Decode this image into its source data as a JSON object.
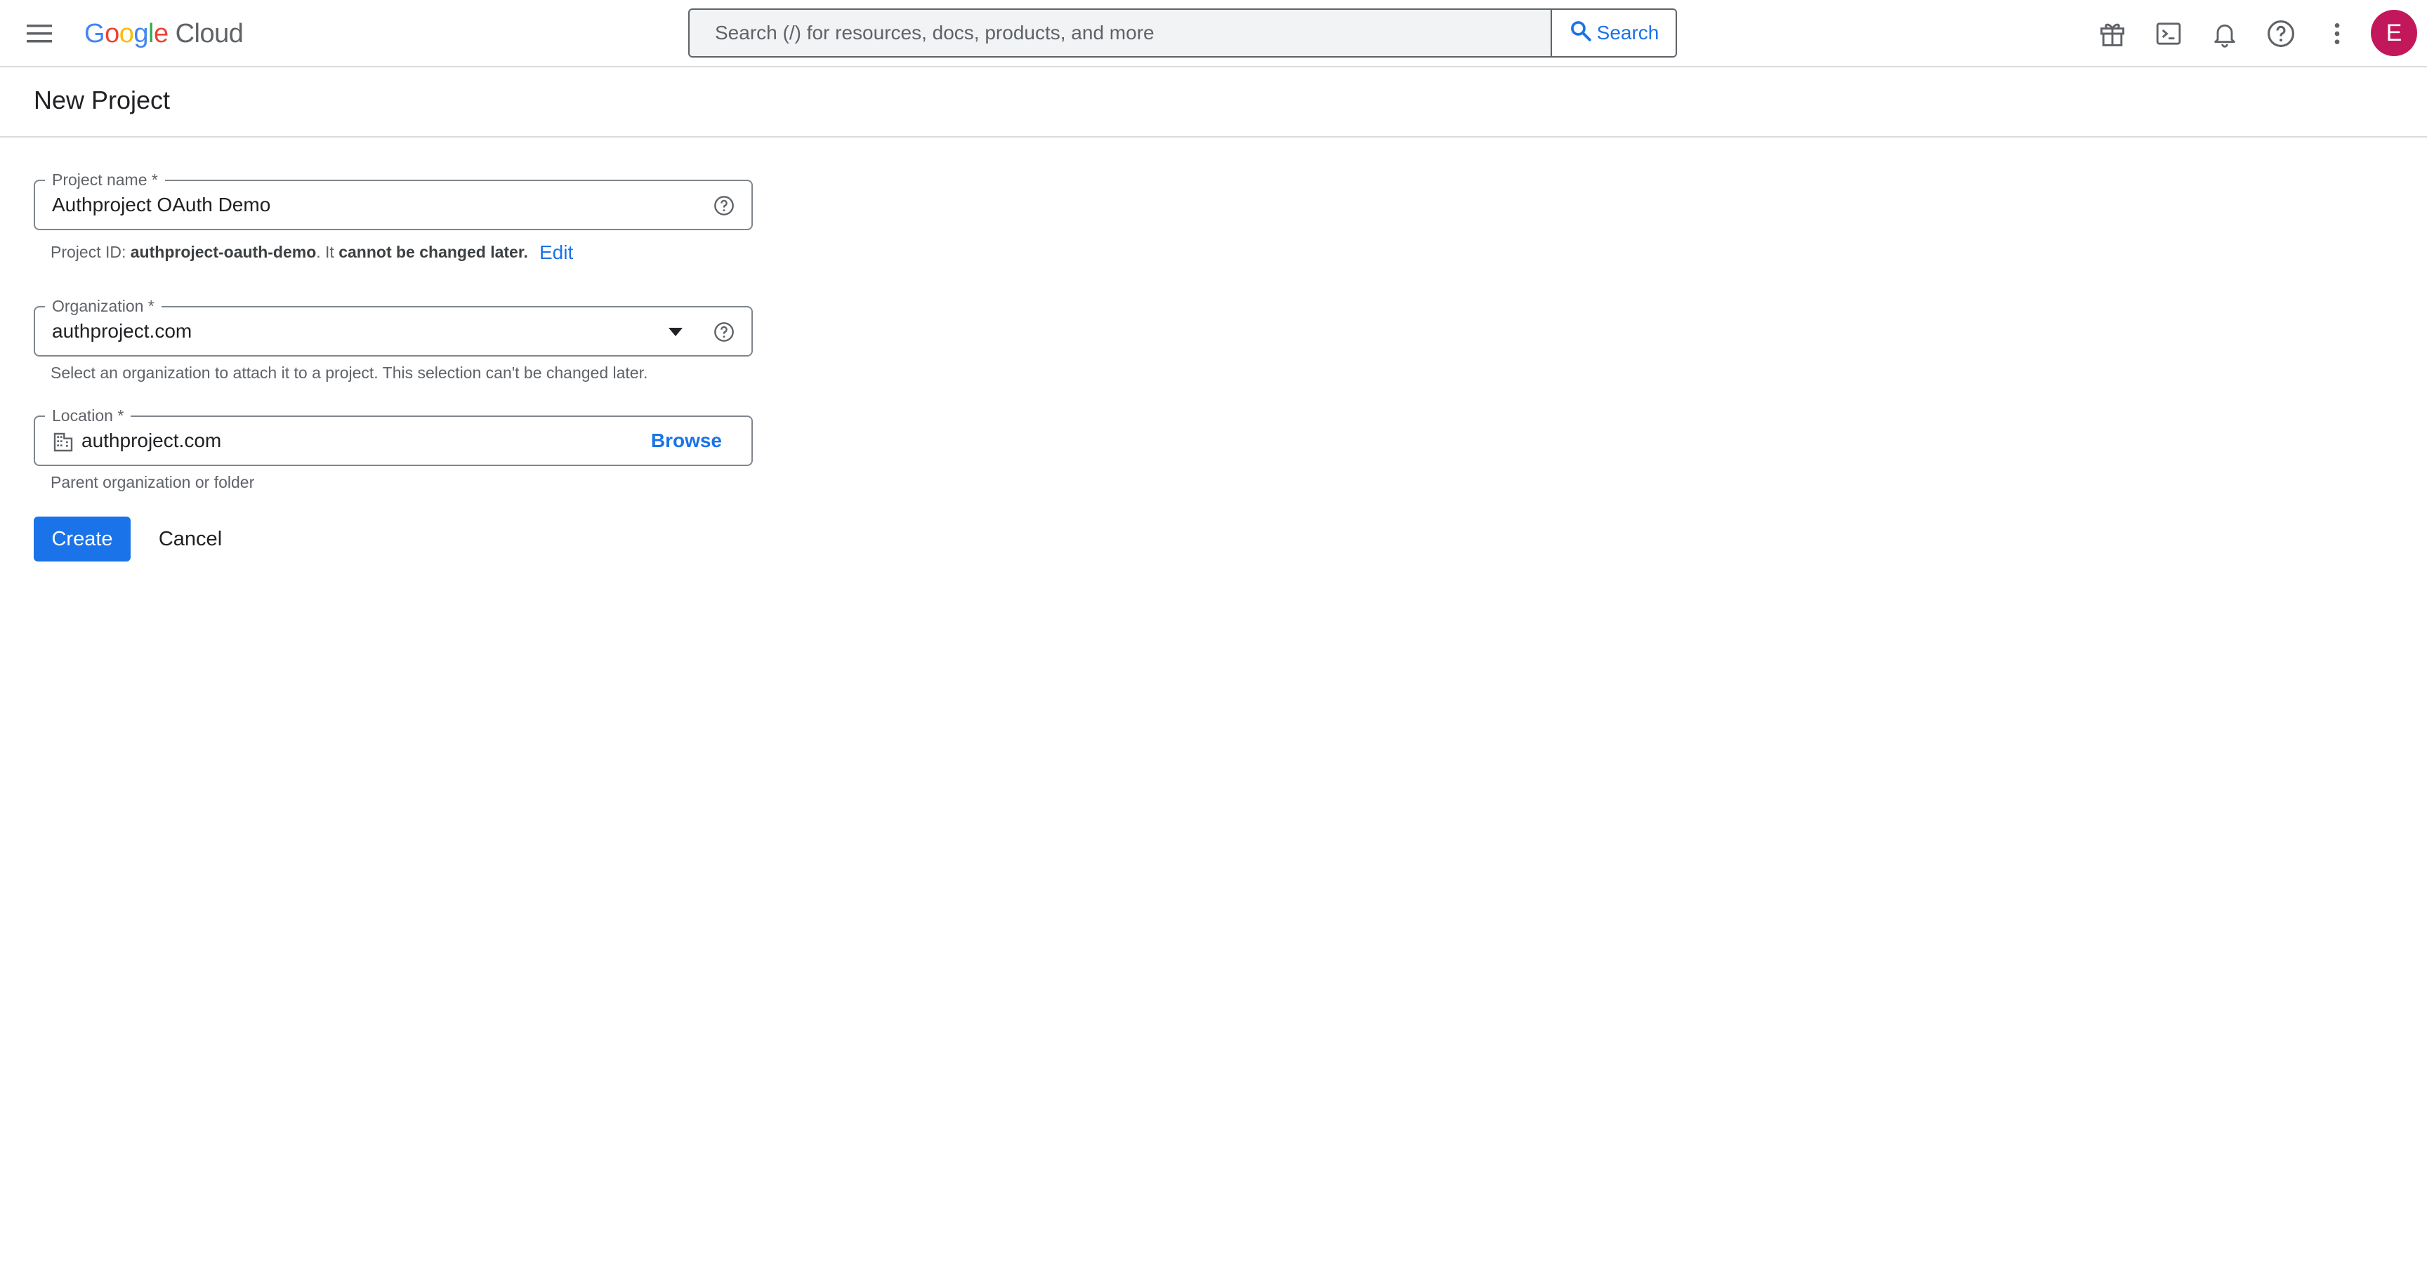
{
  "header": {
    "logo_google": [
      "G",
      "o",
      "o",
      "g",
      "l",
      "e"
    ],
    "logo_cloud": "Cloud",
    "search_placeholder": "Search (/) for resources, docs, products, and more",
    "search_button_label": "Search",
    "avatar_initial": "E",
    "avatar_color": "#c2185b",
    "icons": [
      "menu-icon",
      "gift-icon",
      "terminal-icon",
      "bell-icon",
      "help-icon",
      "more-vert-icon"
    ]
  },
  "page": {
    "title": "New Project"
  },
  "form": {
    "project_name": {
      "label": "Project name *",
      "value": "Authproject OAuth Demo"
    },
    "project_id_hint": {
      "prefix": "Project ID: ",
      "id": "authproject-oauth-demo",
      "middle": ". It ",
      "emphasis": "cannot be changed later.",
      "edit_label": "Edit"
    },
    "organization": {
      "label": "Organization *",
      "value": "authproject.com",
      "hint": "Select an organization to attach it to a project. This selection can't be changed later."
    },
    "location": {
      "label": "Location *",
      "value": "authproject.com",
      "browse_label": "Browse",
      "hint": "Parent organization or folder"
    },
    "actions": {
      "create_label": "Create",
      "cancel_label": "Cancel"
    }
  },
  "colors": {
    "accent": "#1a73e8",
    "border": "#80868b",
    "hint_text": "#5f6368"
  }
}
